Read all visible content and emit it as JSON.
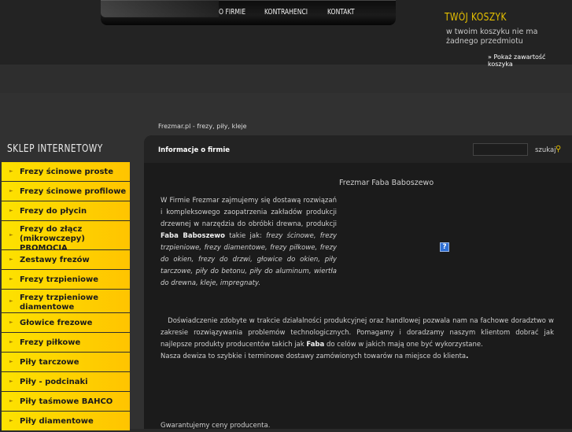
{
  "nav": {
    "items": [
      "O FIRMIE",
      "KONTRAHENCI",
      "KONTAKT"
    ]
  },
  "cart": {
    "title": "TWÓJ KOSZYK",
    "empty_text": "w twoim koszyku nie ma żadnego przedmiotu",
    "show_link": "» Pokaż zawartość koszyka"
  },
  "breadcrumb": "Frezmar.pl - frezy, piły, kleje",
  "shop": {
    "title": "SKLEP INTERNETOWY",
    "categories": [
      "Frezy ścinowe proste",
      "Frezy ścinowe profilowe",
      "Frezy do płycin",
      "Frezy do złącz (mikrowczepy) PROMOCJA",
      "Zestawy frezów",
      "Frezy trzpieniowe",
      "Frezy trzpieniowe diamentowe",
      "Głowice frezowe",
      "Frezy piłkowe",
      "Piły tarczowe",
      "Piły - podcinaki",
      "Piły taśmowe BAHCO",
      "Piły diamentowe"
    ]
  },
  "main": {
    "heading": "Informacje o firmie",
    "search_value": "",
    "search_label": "szukaj",
    "content_title": "Frezmar Faba Baboszewo",
    "p1_pre": "W  Firmie Frezmar zajmujemy się dostawą rozwiązań i kompleksowego zaopatrzenia zakładów produkcji drzewnej w narzędzia do obróbki drewna, produkcji ",
    "p1_bold": "Faba Baboszewo",
    "p1_mid": " takie jak: ",
    "p1_italic": "frezy ścinowe, frezy trzpieniowe, frezy diamentowe, frezy piłkowe, frezy do okien, frezy do drzwi, głowice do okien, piły tarczowe, piły do betonu, piły do aluminum, wiertła do drewna, kleje, impregnaty.",
    "p2_pre": "Doświadczenie zdobyte w trakcie działalności produkcyjnej oraz handlowej pozwala nam na fachowe doradztwo w zakresie rozwiązywania problemów technologicznych. Pomagamy i doradzamy naszym klientom dobrać jak najlepsze produkty producentów takich jak ",
    "p2_bold": "Faba",
    "p2_post": " do celów w jakich mają one być wykorzystane.",
    "p2_line2": "Nasza dewiza to szybkie i terminowe dostawy zamówionych towarów na miejsce do klienta",
    "p2_dot": ".",
    "p3": "Gwarantujemy ceny producenta."
  }
}
